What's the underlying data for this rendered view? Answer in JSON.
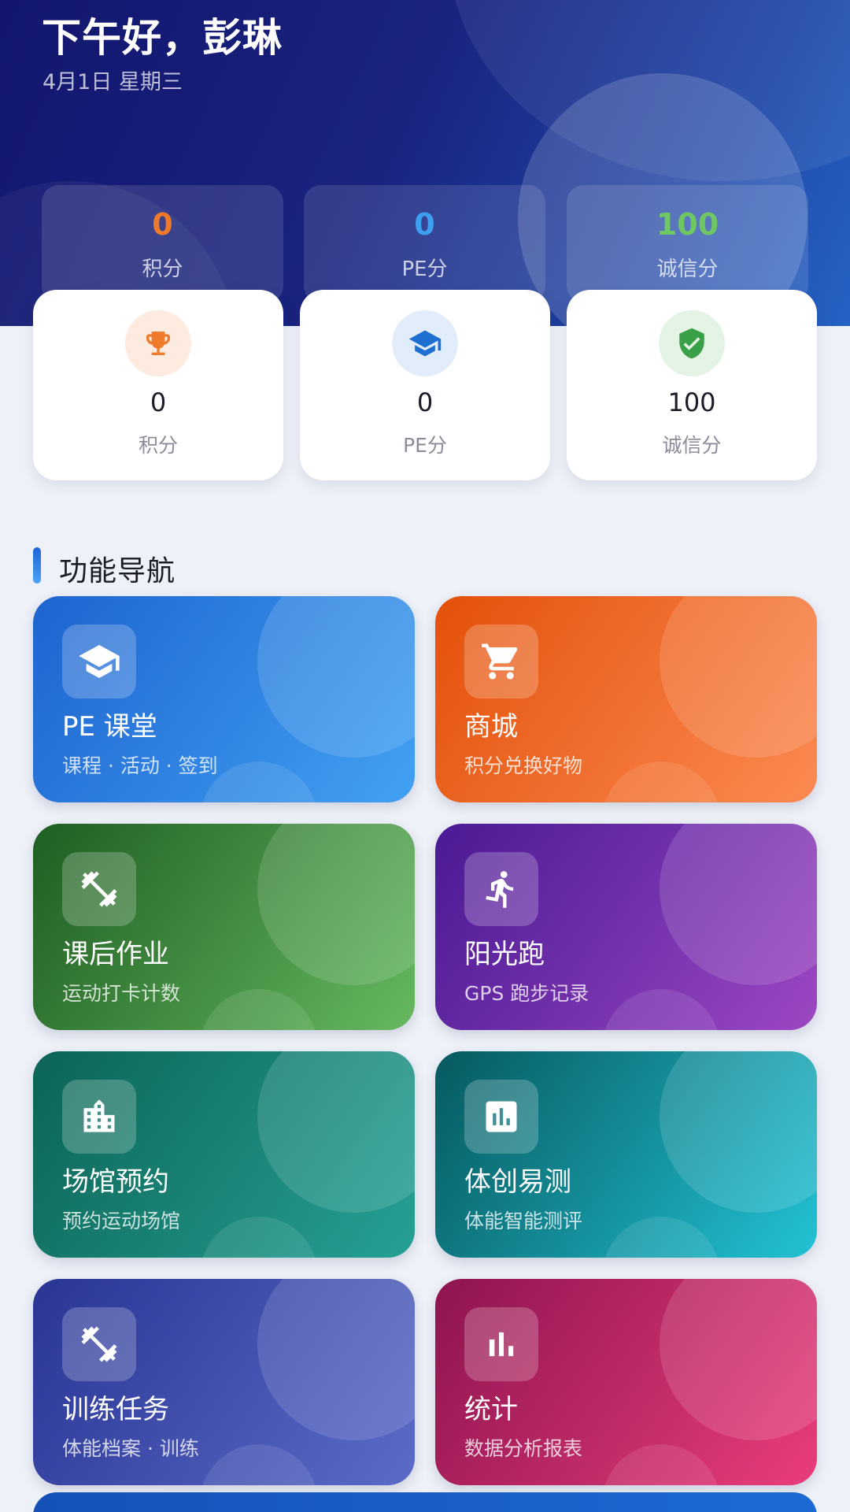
{
  "header": {
    "greeting": "下午好，彭琳",
    "date": "4月1日 星期三",
    "stats": [
      {
        "value": "0",
        "label": "积分",
        "color": "#f07a2c"
      },
      {
        "value": "0",
        "label": "PE分",
        "color": "#3ea0f0"
      },
      {
        "value": "100",
        "label": "诚信分",
        "color": "#6fc763"
      }
    ]
  },
  "stat_cards": [
    {
      "icon": "trophy-icon",
      "value": "0",
      "label": "积分",
      "icon_color": "#f07a2c",
      "icon_bg": "#fdebe0"
    },
    {
      "icon": "graduation-cap-icon",
      "value": "0",
      "label": "PE分",
      "icon_color": "#1e6fd2",
      "icon_bg": "#e2edfb"
    },
    {
      "icon": "shield-check-icon",
      "value": "100",
      "label": "诚信分",
      "icon_color": "#3aa048",
      "icon_bg": "#e3f3e4"
    }
  ],
  "section": {
    "title": "功能导航"
  },
  "features": [
    {
      "icon": "graduation-cap-icon",
      "title": "PE 课堂",
      "subtitle": "课程 · 活动 · 签到",
      "colors": [
        "#1e64d0",
        "#42a1f2"
      ]
    },
    {
      "icon": "shopping-cart-icon",
      "title": "商城",
      "subtitle": "积分兑换好物",
      "colors": [
        "#e4510a",
        "#fb8a52"
      ]
    },
    {
      "icon": "dumbbell-icon",
      "title": "课后作业",
      "subtitle": "运动打卡计数",
      "colors": [
        "#1f5e22",
        "#66b860"
      ]
    },
    {
      "icon": "running-icon",
      "title": "阳光跑",
      "subtitle": "GPS 跑步记录",
      "colors": [
        "#4a1a94",
        "#9c47c2"
      ]
    },
    {
      "icon": "building-icon",
      "title": "场馆预约",
      "subtitle": "预约运动场馆",
      "colors": [
        "#0c6455",
        "#26a195"
      ]
    },
    {
      "icon": "assessment-icon",
      "title": "体创易测",
      "subtitle": "体能智能测评",
      "colors": [
        "#07595f",
        "#22c2d4"
      ]
    },
    {
      "icon": "dumbbell-icon",
      "title": "训练任务",
      "subtitle": "体能档案 · 训练",
      "colors": [
        "#2a3594",
        "#5c6bc8"
      ]
    },
    {
      "icon": "bar-chart-icon",
      "title": "统计",
      "subtitle": "数据分析报表",
      "colors": [
        "#8e1450",
        "#ea3d7c"
      ]
    }
  ]
}
